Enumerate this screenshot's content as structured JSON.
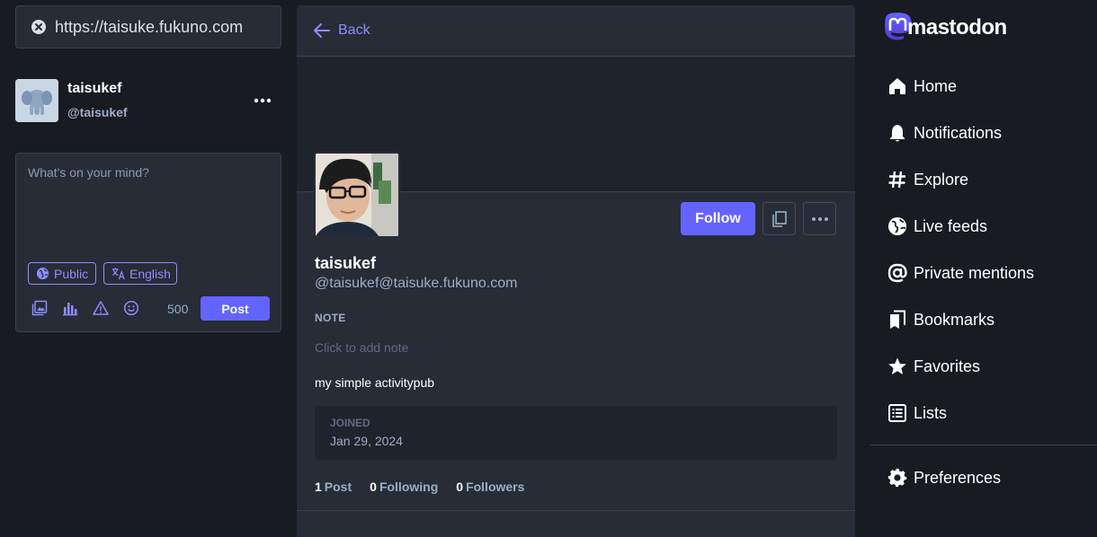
{
  "colors": {
    "background": "#191b22",
    "panel": "#282c37",
    "accent": "#6364ff",
    "accent_text": "#8c8dff",
    "muted_text": "#9baec8"
  },
  "search": {
    "value": "https://taisuke.fukuno.com",
    "clear_icon": "close-circle-icon"
  },
  "account": {
    "display_name": "taisukef",
    "handle": "@taisukef",
    "menu_icon": "ellipsis-icon"
  },
  "composer": {
    "placeholder": "What's on your mind?",
    "visibility_label": "Public",
    "language_label": "English",
    "char_count": "500",
    "post_label": "Post",
    "tool_icons": [
      "image-icon",
      "poll-icon",
      "warning-icon",
      "emoji-icon"
    ]
  },
  "profile": {
    "back_label": "Back",
    "display_name": "taisukef",
    "handle": "@taisukef@taisuke.fukuno.com",
    "follow_label": "Follow",
    "note_label": "NOTE",
    "note_placeholder": "Click to add note",
    "bio": "my simple activitypub",
    "joined_label": "JOINED",
    "joined_date": "Jan 29, 2024",
    "stats": [
      {
        "count": "1",
        "label": "Post"
      },
      {
        "count": "0",
        "label": "Following"
      },
      {
        "count": "0",
        "label": "Followers"
      }
    ]
  },
  "brand": {
    "wordmark": "mastodon"
  },
  "nav": {
    "items": [
      {
        "label": "Home",
        "icon": "home-icon"
      },
      {
        "label": "Notifications",
        "icon": "bell-icon"
      },
      {
        "label": "Explore",
        "icon": "hashtag-icon"
      },
      {
        "label": "Live feeds",
        "icon": "globe-icon"
      },
      {
        "label": "Private mentions",
        "icon": "at-icon"
      },
      {
        "label": "Bookmarks",
        "icon": "bookmark-icon"
      },
      {
        "label": "Favorites",
        "icon": "star-icon"
      },
      {
        "label": "Lists",
        "icon": "list-icon"
      }
    ],
    "preferences_label": "Preferences"
  }
}
